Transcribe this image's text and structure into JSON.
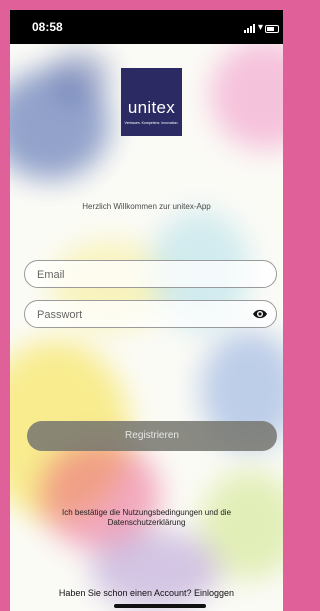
{
  "status_bar": {
    "time": "08:58"
  },
  "logo": {
    "name": "unitex",
    "tagline": "Vertrauen. Kompetenz. Innovation."
  },
  "welcome_text": "Herzlich Willkommen zur unitex-App",
  "form": {
    "email_placeholder": "Email",
    "password_placeholder": "Passwort"
  },
  "register_label": "Registrieren",
  "terms": {
    "prefix": "Ich bestätige die ",
    "terms_link": "Nutzungsbedingungen",
    "middle": " und die",
    "privacy_link": "Datenschutzerklärung"
  },
  "login": {
    "question": "Haben Sie schon einen Account?",
    "link": "Einloggen"
  },
  "colors": {
    "frame": "#e0609a",
    "button": "#76766e",
    "logo_bg": "#2c2a63"
  },
  "icons": [
    "signal-icon",
    "wifi-icon",
    "battery-icon",
    "eye-icon"
  ]
}
